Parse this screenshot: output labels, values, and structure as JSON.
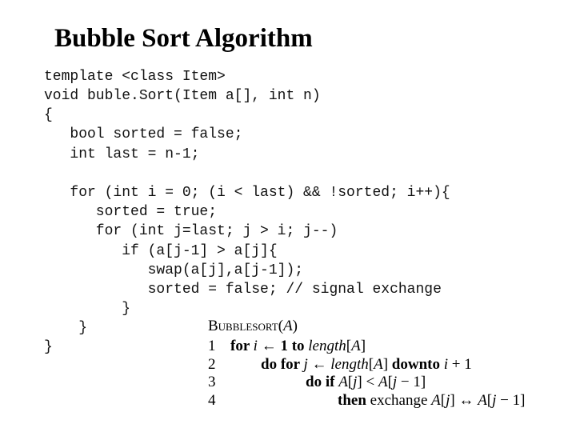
{
  "slide": {
    "title": "Bubble Sort Algorithm"
  },
  "cpp_code": {
    "lines": [
      "template <class Item>",
      "void buble.Sort(Item a[], int n)",
      "{",
      "   bool sorted = false;",
      "   int last = n-1;",
      "",
      "   for (int i = 0; (i < last) && !sorted; i++){",
      "      sorted = true;",
      "      for (int j=last; j > i; j--)",
      "         if (a[j-1] > a[j]{",
      "            swap(a[j],a[j-1]);",
      "            sorted = false; // signal exchange",
      "         }",
      "    }",
      "}"
    ]
  },
  "pseudocode": {
    "header_name": "Bubblesort",
    "header_arg_open": "(",
    "header_arg": "A",
    "header_arg_close": ")",
    "lines": [
      {
        "number": "1",
        "parts": [
          {
            "text": "for ",
            "style": "kw"
          },
          {
            "text": "i",
            "style": "it"
          },
          {
            "text": " ← ",
            "style": ""
          },
          {
            "text": "1 ",
            "style": "kw"
          },
          {
            "text": "to ",
            "style": "kw"
          },
          {
            "text": "length",
            "style": "it"
          },
          {
            "text": "[",
            "style": ""
          },
          {
            "text": "A",
            "style": "it"
          },
          {
            "text": "]",
            "style": ""
          }
        ]
      },
      {
        "number": "2",
        "parts": [
          {
            "text": "do for ",
            "style": "kw"
          },
          {
            "text": "j",
            "style": "it"
          },
          {
            "text": " ← ",
            "style": ""
          },
          {
            "text": "length",
            "style": "it"
          },
          {
            "text": "[",
            "style": ""
          },
          {
            "text": "A",
            "style": "it"
          },
          {
            "text": "] ",
            "style": ""
          },
          {
            "text": "downto ",
            "style": "kw"
          },
          {
            "text": "i",
            "style": "it"
          },
          {
            "text": " + 1",
            "style": ""
          }
        ]
      },
      {
        "number": "3",
        "parts": [
          {
            "text": "do if ",
            "style": "kw"
          },
          {
            "text": "A",
            "style": "it"
          },
          {
            "text": "[",
            "style": ""
          },
          {
            "text": "j",
            "style": "it"
          },
          {
            "text": "] < ",
            "style": ""
          },
          {
            "text": "A",
            "style": "it"
          },
          {
            "text": "[",
            "style": ""
          },
          {
            "text": "j",
            "style": "it"
          },
          {
            "text": " − 1]",
            "style": ""
          }
        ]
      },
      {
        "number": "4",
        "parts": [
          {
            "text": "then ",
            "style": "kw"
          },
          {
            "text": "exchange ",
            "style": ""
          },
          {
            "text": "A",
            "style": "it"
          },
          {
            "text": "[",
            "style": ""
          },
          {
            "text": "j",
            "style": "it"
          },
          {
            "text": "] ↔ ",
            "style": ""
          },
          {
            "text": "A",
            "style": "it"
          },
          {
            "text": "[",
            "style": ""
          },
          {
            "text": "j",
            "style": "it"
          },
          {
            "text": " − 1]",
            "style": ""
          }
        ]
      }
    ]
  }
}
